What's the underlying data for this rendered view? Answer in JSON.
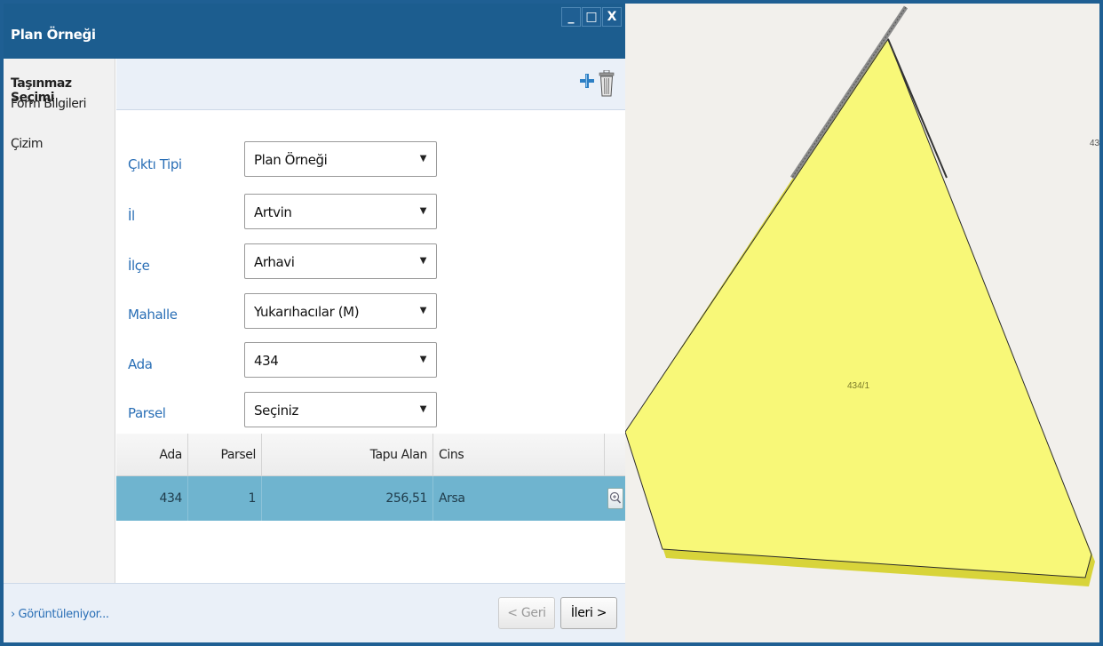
{
  "window": {
    "title": "Plan Örneği",
    "controls": {
      "minimize": "_",
      "maximize": "□",
      "close": "X"
    }
  },
  "sidebar": {
    "items": [
      {
        "label": "Taşınmaz Seçimi",
        "active": true
      },
      {
        "label": "Form Bilgileri",
        "active": false
      },
      {
        "label": "Çizim",
        "active": false
      }
    ]
  },
  "toolbar": {
    "add_icon": "plus-icon",
    "delete_icon": "trash-icon"
  },
  "form": {
    "fields": [
      {
        "label": "Çıktı Tipi",
        "value": "Plan Örneği"
      },
      {
        "label": "İl",
        "value": "Artvin"
      },
      {
        "label": "İlçe",
        "value": "Arhavi"
      },
      {
        "label": "Mahalle",
        "value": "Yukarıhacılar (M)"
      },
      {
        "label": "Ada",
        "value": "434"
      },
      {
        "label": "Parsel",
        "value": "Seçiniz"
      }
    ]
  },
  "grid": {
    "headers": [
      "Ada",
      "Parsel",
      "Tapu Alan",
      "Cins"
    ],
    "rows": [
      {
        "ada": "434",
        "parsel": "1",
        "tapu_alan": "256,51",
        "cins": "Arsa"
      }
    ]
  },
  "footer": {
    "status": "› Görüntüleniyor...",
    "back_label": "< Geri",
    "next_label": "İleri >"
  },
  "map": {
    "parcel_label": "434/1",
    "edge_label": "43",
    "parcel_color": "#f8f878"
  },
  "colors": {
    "accent": "#1c5d8f",
    "label_blue": "#2a6fb6",
    "row_selected": "#6fb4cf"
  }
}
